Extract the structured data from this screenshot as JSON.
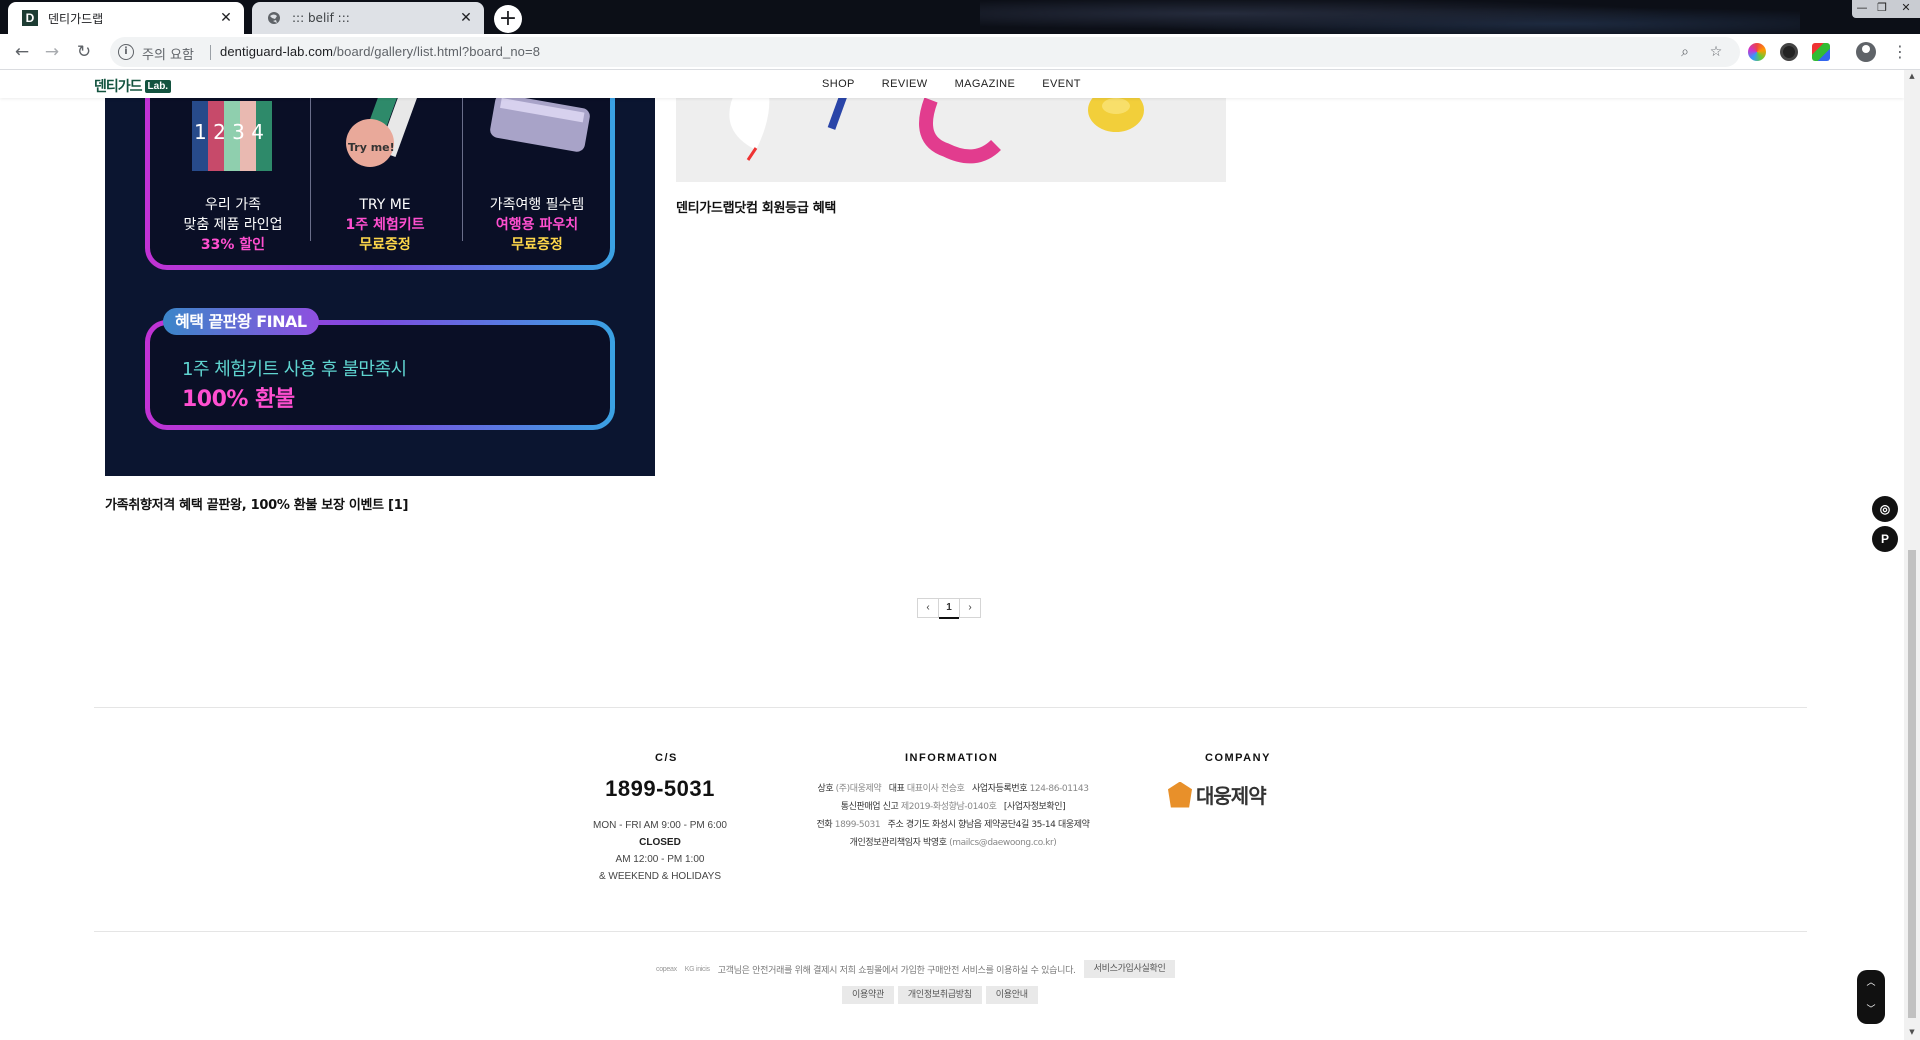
{
  "browser": {
    "tabs": [
      {
        "title": "덴티가드랩",
        "favicon": "D",
        "active": true
      },
      {
        "title": "::: belif :::",
        "favicon": "globe",
        "active": false
      }
    ],
    "new_tab": "+",
    "window_controls": [
      "—",
      "❐",
      "✕"
    ],
    "address_warning": "주의 요함",
    "url_host": "dentiguard-lab.com",
    "url_path": "/board/gallery/list.html?board_no=8",
    "nav": {
      "back": "←",
      "forward": "→",
      "reload": "↻"
    }
  },
  "site": {
    "logo_text": "덴티가드",
    "logo_badge": "Lab.",
    "menu": [
      "SHOP",
      "REVIEW",
      "MAGAZINE",
      "EVENT"
    ]
  },
  "gallery": {
    "items": [
      {
        "caption": "가족취향저격 혜택 끝판왕, 100% 환불 보장 이벤트 [1]",
        "banner": {
          "columns": [
            {
              "line1": "우리 가족",
              "line2": "맞춤 제품 라인업",
              "highlight": "33% 할인",
              "highlight_color": "#ffd84a"
            },
            {
              "line1": "TRY ME",
              "line2": "1주 체험키트",
              "highlight": "무료증정",
              "line2_color": "#ff4fd0",
              "highlight_color": "#ffd84a"
            },
            {
              "line1": "가족여행 필수템",
              "line2": "여행용 파우치",
              "highlight": "무료증정",
              "line2_color": "#ff4fd0",
              "highlight_color": "#ffd84a"
            }
          ],
          "kit_label": "Try me!",
          "final_badge": "혜택 끝판왕 FINAL",
          "final_line1": "1주 체험키트 사용 후 불만족시",
          "final_line2": "100% 환불"
        }
      },
      {
        "caption": "덴티가드랩닷컴 회원등급 혜택"
      }
    ]
  },
  "pagination": {
    "prev": "‹",
    "current": "1",
    "next": "›"
  },
  "footer": {
    "cs": {
      "heading": "C/S",
      "phone": "1899-5031",
      "hours": "MON - FRI AM 9:00 - PM 6:00",
      "closed": "CLOSED",
      "lunch": "AM 12:00 - PM 1:00",
      "holiday": "& WEEKEND & HOLIDAYS"
    },
    "information": {
      "heading": "INFORMATION",
      "line1_k1": "상호",
      "line1_v1": "(주)대웅제약",
      "line1_k2": "대표",
      "line1_v2": "대표이사 전승호",
      "line1_k3": "사업자등록번호",
      "line1_v3": "124-86-01143",
      "line2_k1": "통신판매업 신고",
      "line2_v1": "제2019-화성향남-0140호",
      "line2_link": "[사업자정보확인]",
      "line3_k1": "전화",
      "line3_v1": "1899-5031",
      "line3_k2": "주소",
      "line3_v2": "경기도 화성시 향남읍 제약공단4길 35-14 대웅제약",
      "line4_k1": "개인정보관리책임자",
      "line4_v1": "박영호",
      "line4_v2": "(mailcs@daewoong.co.kr)"
    },
    "company": {
      "heading": "COMPANY",
      "name": "대웅제약"
    },
    "escrow_logos": [
      "copeax",
      "KG inicis"
    ],
    "escrow_text": "고객님은 안전거래를 위해 결제시 저희 쇼핑몰에서 가입한 구매안전 서비스를 이용하실 수 있습니다.",
    "escrow_button": "서비스가입사실확인",
    "policy_links": [
      "이용약관",
      "개인정보취급방침",
      "이용안내"
    ]
  },
  "floating": {
    "camera": "◎",
    "p": "P",
    "up": "︿",
    "down": "﹀"
  },
  "colors": {
    "brand": "#13533f",
    "banner_bg": "#0b1530",
    "magenta": "#ff4fd0",
    "cyan": "#5fd4d0"
  }
}
